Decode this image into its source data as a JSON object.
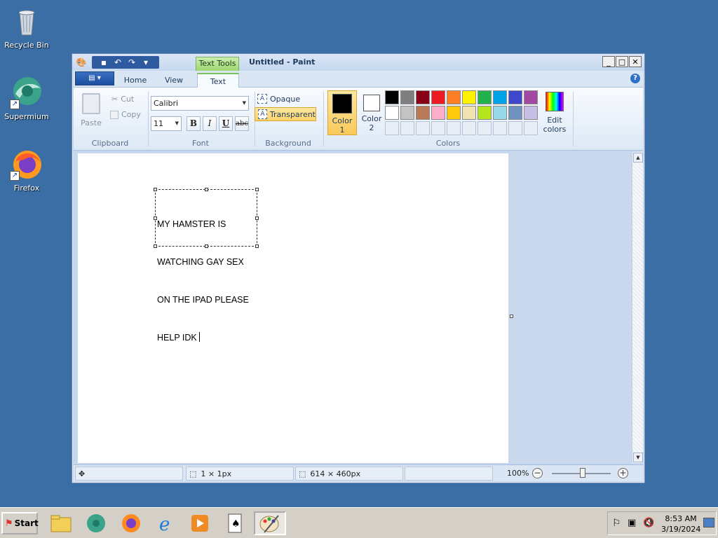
{
  "desktop": {
    "icons": [
      {
        "label": "Recycle Bin"
      },
      {
        "label": "Supermium"
      },
      {
        "label": "Firefox"
      }
    ]
  },
  "window": {
    "context_tab": "Text Tools",
    "title": "Untitled - Paint",
    "controls": {
      "minimize": "_",
      "maximize": "□",
      "close": "✕"
    }
  },
  "ribbon": {
    "tabs": [
      {
        "label": "Home"
      },
      {
        "label": "View"
      },
      {
        "label": "Text"
      }
    ],
    "clipboard": {
      "paste": "Paste",
      "cut": "Cut",
      "copy": "Copy",
      "group": "Clipboard"
    },
    "font": {
      "family": "Calibri",
      "size": "11",
      "bold": "B",
      "italic": "I",
      "underline": "U",
      "strike": "abc",
      "group": "Font"
    },
    "background": {
      "opaque": "Opaque",
      "transparent": "Transparent",
      "selected": "Transparent",
      "group": "Background"
    },
    "colors": {
      "color1_label": "Color\n1",
      "color1_l1": "Color",
      "color1_l2": "1",
      "color2_l1": "Color",
      "color2_l2": "2",
      "color1": "#000000",
      "color2": "#ffffff",
      "edit_l1": "Edit",
      "edit_l2": "colors",
      "group": "Colors",
      "palette_row1": [
        "#000000",
        "#7f7f7f",
        "#880015",
        "#ed1c24",
        "#ff7f27",
        "#fff200",
        "#22b14c",
        "#00a2e8",
        "#3f48cc",
        "#a349a4"
      ],
      "palette_row2": [
        "#ffffff",
        "#c3c3c3",
        "#b97a57",
        "#ffaec9",
        "#ffc90e",
        "#efe4b0",
        "#b5e61d",
        "#99d9ea",
        "#7092be",
        "#c8bfe7"
      ]
    }
  },
  "canvas": {
    "text_lines": [
      "MY HAMSTER IS",
      "WATCHING GAY SEX",
      "ON THE IPAD PLEASE",
      "HELP IDK"
    ]
  },
  "statusbar": {
    "selection_size": "1 × 1px",
    "canvas_size": "614 × 460px",
    "zoom": "100%"
  },
  "taskbar": {
    "start_label": "Start",
    "time": "8:53 AM",
    "date": "3/19/2024"
  }
}
